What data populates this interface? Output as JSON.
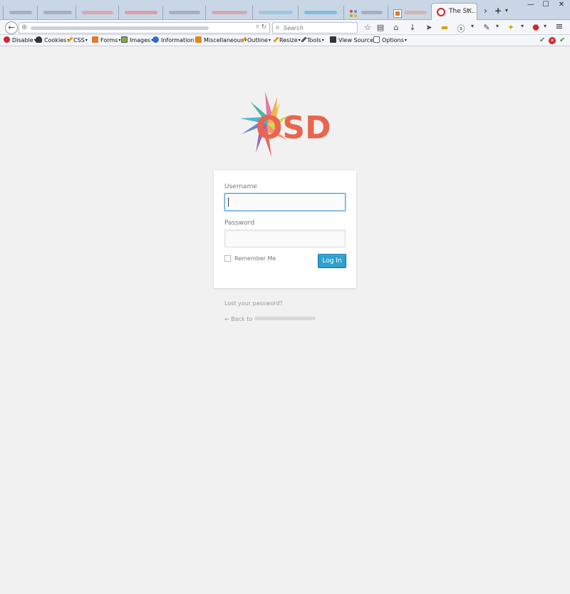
{
  "browser": {
    "active_tab": {
      "title": "The St..."
    },
    "search": {
      "placeholder": "Search"
    }
  },
  "devtoolbar": {
    "items": [
      {
        "label": "Disable"
      },
      {
        "label": "Cookies"
      },
      {
        "label": "CSS"
      },
      {
        "label": "Forms"
      },
      {
        "label": "Images"
      },
      {
        "label": "Information"
      },
      {
        "label": "Miscellaneous"
      },
      {
        "label": "Outline"
      },
      {
        "label": "Resize"
      },
      {
        "label": "Tools"
      },
      {
        "label": "View Source"
      },
      {
        "label": "Options"
      }
    ]
  },
  "page": {
    "logo_text": "OSD",
    "form": {
      "username_label": "Username",
      "username_value": "",
      "password_label": "Password",
      "password_value": "",
      "remember_label": "Remember Me",
      "remember_checked": false,
      "submit_label": "Log In"
    },
    "lost_password": "Lost your password?",
    "back_prefix": "← Back to"
  },
  "colors": {
    "accent": "#2ea2cc",
    "logo_text": "#e8654f",
    "background": "#f1f1f1"
  }
}
